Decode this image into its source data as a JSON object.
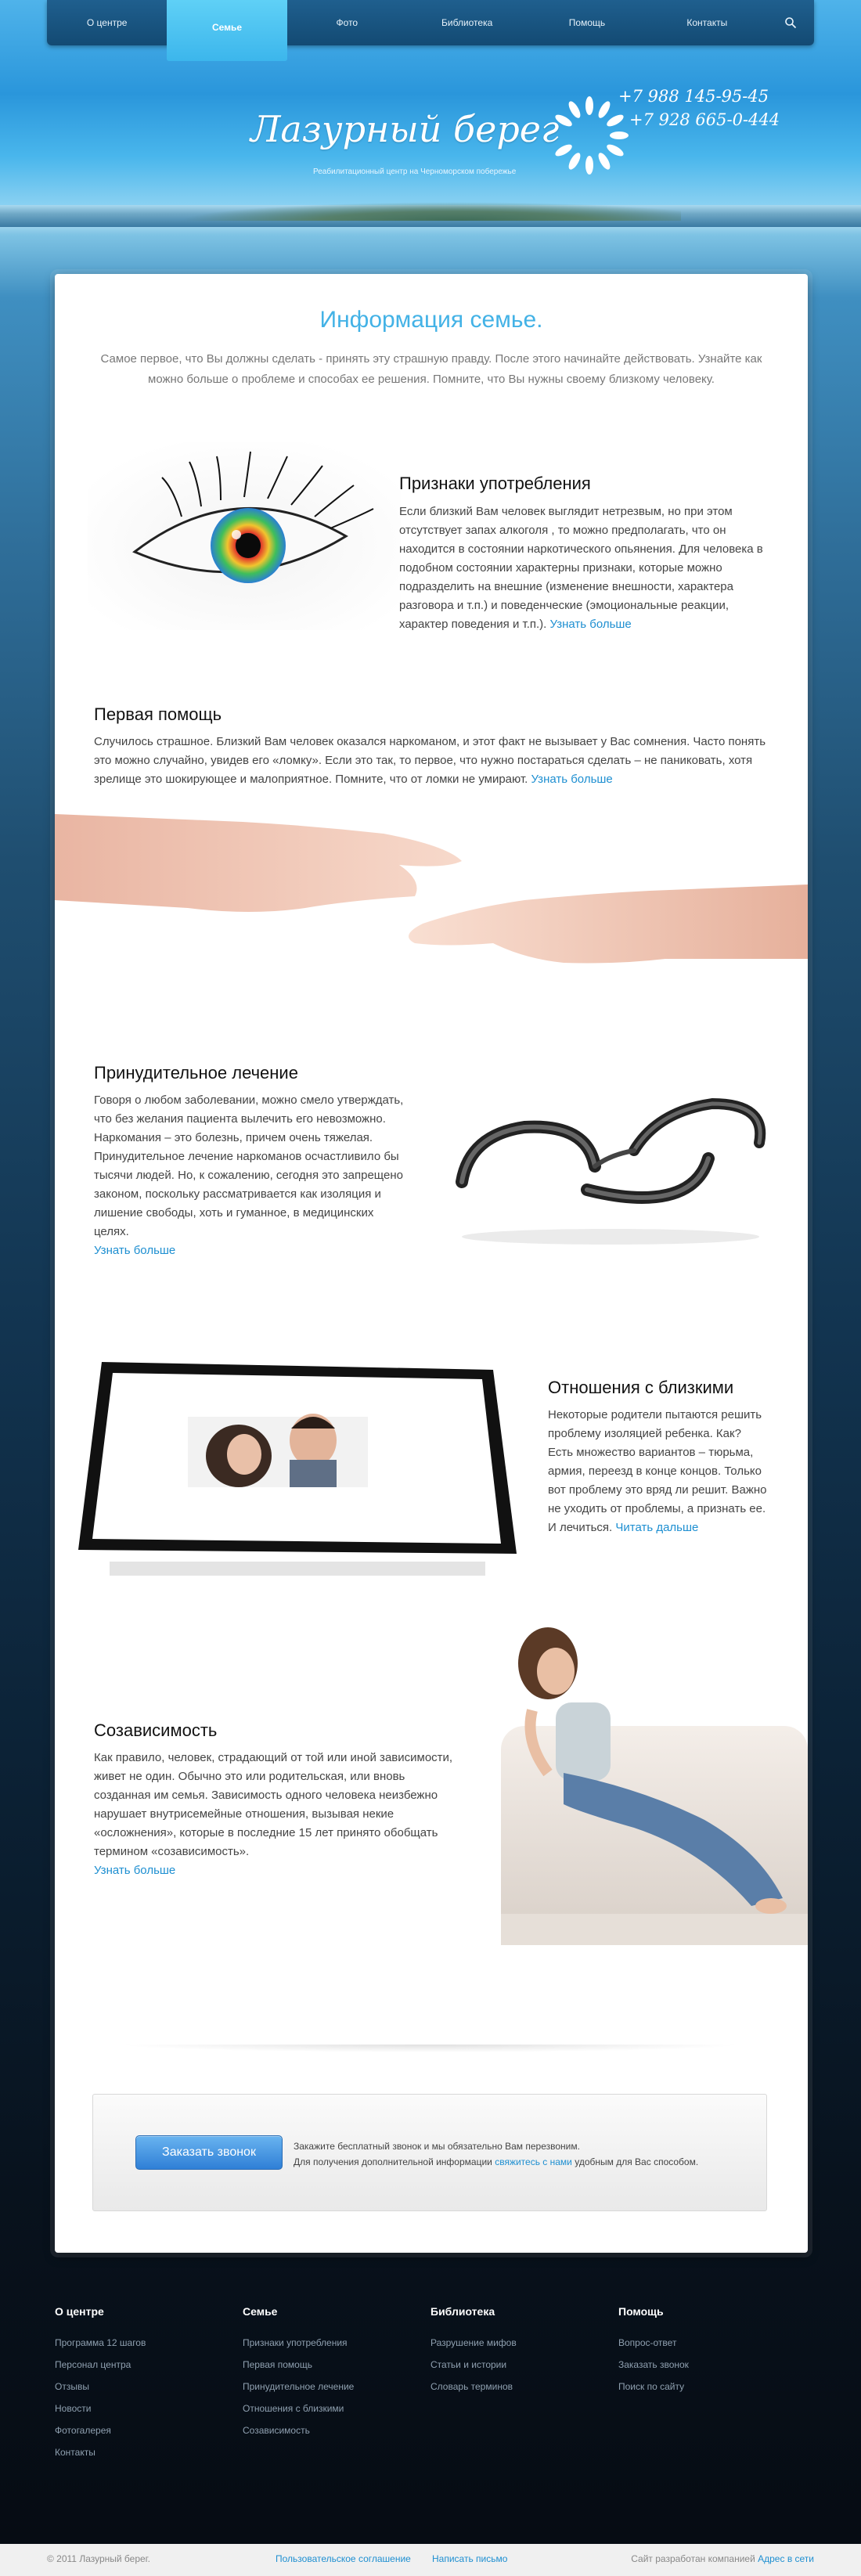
{
  "nav": {
    "items": [
      {
        "label": "О центре",
        "active": false
      },
      {
        "label": "Семье",
        "active": true
      },
      {
        "label": "Фото",
        "active": false
      },
      {
        "label": "Библиотека",
        "active": false
      },
      {
        "label": "Помощь",
        "active": false
      },
      {
        "label": "Контакты",
        "active": false
      }
    ],
    "search_icon": "search-icon"
  },
  "header": {
    "logo_text": "Лазурный берег",
    "tagline": "Реабилитационный центр на Черноморском побережье",
    "phones": [
      "+7 988 145-95-45",
      "+7 928 665-0-444"
    ]
  },
  "main": {
    "title": "Информация семье.",
    "intro": "Самое первое, что Вы должны сделать - принять эту страшную правду. После этого начинайте действовать. Узнайте как можно больше о проблеме и способах ее решения. Помните, что Вы нужны своему близкому человеку.",
    "sections": [
      {
        "heading": "Признаки употребления",
        "text": "Если близкий Вам человек выглядит нетрезвым, но при этом отсутствует запах алкоголя , то можно предполагать, что он находится в состоянии наркотического опьянения. Для человека в подобном состоянии характерны признаки, которые можно подразделить на внешние (изменение внешности, характера разговора и т.п.) и поведенческие (эмоциональные реакции, характер поведения и т.п.).",
        "link": "Узнать больше"
      },
      {
        "heading": "Первая помощь",
        "text": "Случилось страшное. Близкий Вам человек оказался наркоманом, и этот факт не вызывает у Вас сомнения. Часто понять это можно случайно, увидев его «ломку». Если это так, то первое, что нужно постараться сделать – не паниковать, хотя зрелище это шокирующее и малоприятное. Помните, что от ломки не умирают.",
        "link": "Узнать больше"
      },
      {
        "heading": "Принудительное лечение",
        "text": "Говоря о любом заболевании, можно смело утверждать, что без желания пациента вылечить его невозможно. Наркомания – это болезнь, причем очень тяжелая. Принудительное лечение наркоманов осчастливило бы тысячи людей. Но, к сожалению, сегодня это запрещено законом, поскольку рассматривается как изоляция и лишение свободы, хоть и гуманное, в медицинских целях.",
        "link": "Узнать больше"
      },
      {
        "heading": "Отношения с близкими",
        "text": "Некоторые родители пытаются решить проблему изоляцией ребенка. Как? Есть множество вариантов – тюрьма, армия, переезд в конце концов. Только вот проблему это вряд ли решит. Важно не уходить от проблемы, а признать ее. И лечиться.",
        "link": "Читать дальше"
      },
      {
        "heading": "Созависимость",
        "text": "Как правило, человек, страдающий от той или иной зависимости, живет не один. Обычно это или родительская, или вновь созданная им семья. Зависимость одного человека неизбежно нарушает внутрисемейные отношения, вызывая некие «осложнения», которые в последние 15 лет принято обобщать термином «созависимость».",
        "link": "Узнать больше"
      }
    ]
  },
  "callback": {
    "button": "Заказать звонок",
    "line1": "Закажите бесплатный звонок и мы обязательно Вам перезвоним.",
    "line2_before": "Для получения дополнительной информации",
    "line2_link": "свяжитесь с нами",
    "line2_after": "удобным для Вас способом."
  },
  "footer": {
    "columns": [
      {
        "title": "О центре",
        "items": [
          "Программа 12 шагов",
          "Персонал центра",
          "Отзывы",
          "Новости",
          "Фотогалерея",
          "Контакты"
        ]
      },
      {
        "title": "Семье",
        "items": [
          "Признаки употребления",
          "Первая помощь",
          "Принудительное лечение",
          "Отношения с близкими",
          "Созависимость"
        ]
      },
      {
        "title": "Библиотека",
        "items": [
          "Разрушение мифов",
          "Статьи и истории",
          "Словарь терминов"
        ]
      },
      {
        "title": "Помощь",
        "items": [
          "Вопрос-ответ",
          "Заказать звонок",
          "Поиск по сайту"
        ]
      }
    ],
    "copyright": "© 2011 Лазурный берег.",
    "agreement": "Пользовательское соглашение",
    "write": "Написать письмо",
    "credit_before": "Сайт разработан компанией",
    "credit_link": "Адрес в сети"
  },
  "colors": {
    "accent": "#43b2e6",
    "link": "#1e8fd1",
    "nav": "#134a73",
    "button": "#2f7fd6"
  }
}
